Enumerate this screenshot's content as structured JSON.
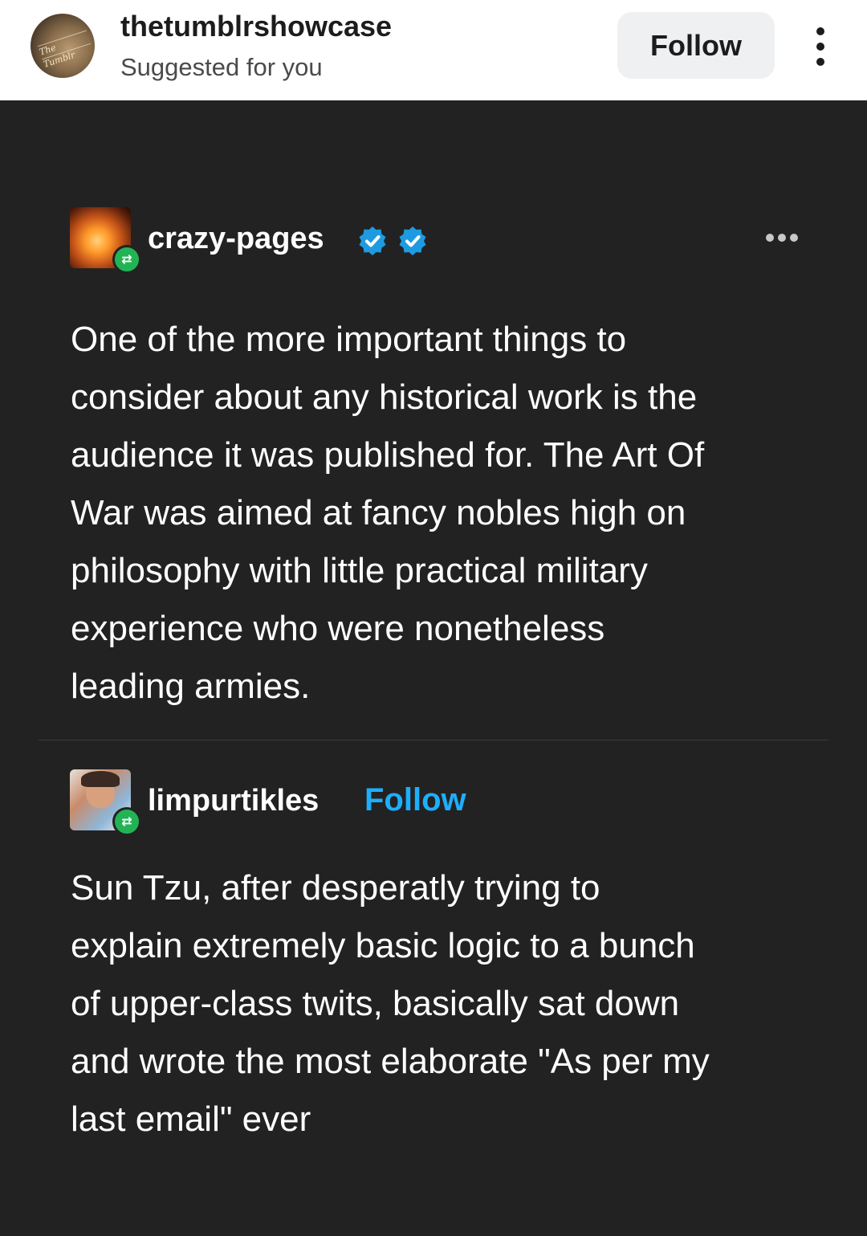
{
  "header": {
    "blog_name": "thetumblrshowcase",
    "subtitle": "Suggested for you",
    "follow_label": "Follow",
    "avatar_logo_text": "The Tumblr"
  },
  "posts": [
    {
      "username": "crazy-pages",
      "verified_badges": 2,
      "text": "One of the more important things to\nconsider about any historical work is the\naudience it was published for. The Art Of\nWar was aimed at fancy nobles high on\nphilosophy with little practical military\nexperience who were nonetheless\nleading armies."
    },
    {
      "username": "limpurtikles",
      "follow_label": "Follow",
      "text": "Sun Tzu, after desperatly trying to\nexplain extremely basic logic to a bunch\nof  upper-class twits, basically sat down\nand wrote the most elaborate \"As per my\nlast email\" ever"
    }
  ],
  "icons": {
    "more_menu": "kebab-vertical-icon",
    "post_menu": "meatballs-horizontal-icon",
    "verified": "verified-check-icon",
    "reblog": "reblog-icon"
  },
  "colors": {
    "background": "#222222",
    "header_background": "#ffffff",
    "follow_button_bg": "#eef0f2",
    "follow_link": "#1eaefc",
    "verified_blue": "#1e9be0",
    "reblog_green": "#22b355"
  }
}
